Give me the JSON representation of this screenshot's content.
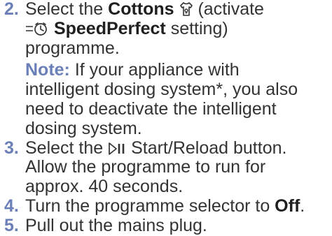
{
  "accent_color": "#6b7fb8",
  "steps": [
    {
      "number": "2.",
      "line1_pre": "Select the ",
      "line1_bold": "Cottons",
      "cottons_icon": "shirt-icon",
      "line1_post": " (activate",
      "speedperfect_icon": "clock-stopwatch-icon",
      "line2_bold": "SpeedPerfect",
      "line2_post": " setting)",
      "line3": "programme.",
      "note_label": "Note:",
      "note_text_1": " If your appliance with",
      "note_text_2": "intelligent dosing system*, you also",
      "note_text_3": "need to deactivate the intelligent",
      "note_text_4": "dosing system."
    },
    {
      "number": "3.",
      "line1_pre": "Select the ",
      "start_icon": "start-pause-icon",
      "line1_post": " Start/Reload button.",
      "line2": "Allow the programme to run for",
      "line3": "approx. 40 seconds."
    },
    {
      "number": "4.",
      "line1_pre": "Turn the programme selector to ",
      "line1_bold": "Off",
      "line1_post": "."
    },
    {
      "number": "5.",
      "line1": "Pull out the mains plug."
    }
  ]
}
